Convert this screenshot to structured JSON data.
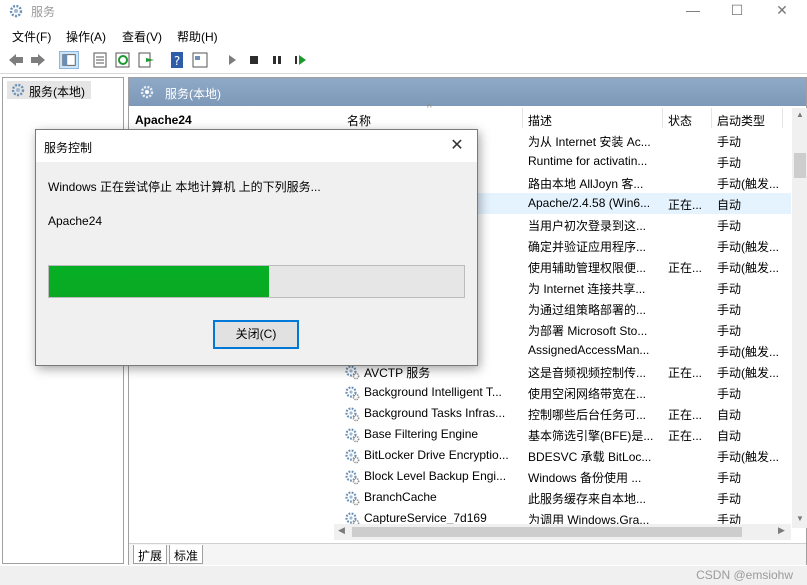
{
  "window": {
    "title": "服务",
    "minimize": "—",
    "maximize": "☐",
    "close": "✕"
  },
  "menu": [
    "文件(F)",
    "操作(A)",
    "查看(V)",
    "帮助(H)"
  ],
  "tree": {
    "root_label": "服务(本地)"
  },
  "panel": {
    "header": "服务(本地)",
    "selected_service": "Apache24"
  },
  "columns": {
    "name": "名称",
    "desc": "描述",
    "status": "状态",
    "startup": "启动类型"
  },
  "rows": [
    {
      "name": "InstSV)",
      "desc": "为从 Internet 安装 Ac...",
      "status": "",
      "startup": "手动"
    },
    {
      "name": "ntime...",
      "desc": "Runtime for activatin...",
      "status": "",
      "startup": "手动"
    },
    {
      "name": "ce",
      "desc": "路由本地 AllJoyn 客...",
      "status": "",
      "startup": "手动(触发..."
    },
    {
      "name": "",
      "desc": "Apache/2.4.58 (Win6...",
      "status": "正在...",
      "startup": "自动"
    },
    {
      "name": "",
      "desc": "当用户初次登录到这...",
      "status": "",
      "startup": "手动"
    },
    {
      "name": "",
      "desc": "确定并验证应用程序...",
      "status": "",
      "startup": "手动(触发..."
    },
    {
      "name": "tion",
      "desc": "使用辅助管理权限便...",
      "status": "正在...",
      "startup": "手动(触发..."
    },
    {
      "name": "atewa...",
      "desc": "为 Internet 连接共享...",
      "status": "",
      "startup": "手动"
    },
    {
      "name": "ement",
      "desc": "为通过组策略部署的...",
      "status": "",
      "startup": "手动"
    },
    {
      "name": "ervic...",
      "desc": "为部署 Microsoft Sto...",
      "status": "",
      "startup": "手动"
    },
    {
      "name": "nager...",
      "desc": "AssignedAccessMan...",
      "status": "",
      "startup": "手动(触发..."
    },
    {
      "name": "AVCTP 服务",
      "desc": "这是音频视频控制传...",
      "status": "正在...",
      "startup": "手动(触发..."
    },
    {
      "name": "Background Intelligent T...",
      "desc": "使用空闲网络带宽在...",
      "status": "",
      "startup": "手动"
    },
    {
      "name": "Background Tasks Infras...",
      "desc": "控制哪些后台任务可...",
      "status": "正在...",
      "startup": "自动"
    },
    {
      "name": "Base Filtering Engine",
      "desc": "基本筛选引擎(BFE)是...",
      "status": "正在...",
      "startup": "自动"
    },
    {
      "name": "BitLocker Drive Encryptio...",
      "desc": "BDESVC 承载 BitLoc...",
      "status": "",
      "startup": "手动(触发..."
    },
    {
      "name": "Block Level Backup Engi...",
      "desc": "Windows 备份使用 ...",
      "status": "",
      "startup": "手动"
    },
    {
      "name": "BranchCache",
      "desc": "此服务缓存来自本地...",
      "status": "",
      "startup": "手动"
    },
    {
      "name": "CaptureService_7d169",
      "desc": "为调用 Windows.Gra...",
      "status": "",
      "startup": "手动"
    }
  ],
  "selected_row_index": 3,
  "tabs": [
    "扩展",
    "标准"
  ],
  "watermark": "CSDN @emsiohw",
  "dialog": {
    "title": "服务控制",
    "message": "Windows 正在尝试停止 本地计算机 上的下列服务...",
    "service": "Apache24",
    "progress": 0.53,
    "close_button": "关闭(C)",
    "close_x": "✕"
  },
  "colors": {
    "progress_green": "#06b025",
    "header_blue": "#8fa9c7",
    "selection": "#e5f3ff",
    "focus_blue": "#0078d7"
  }
}
